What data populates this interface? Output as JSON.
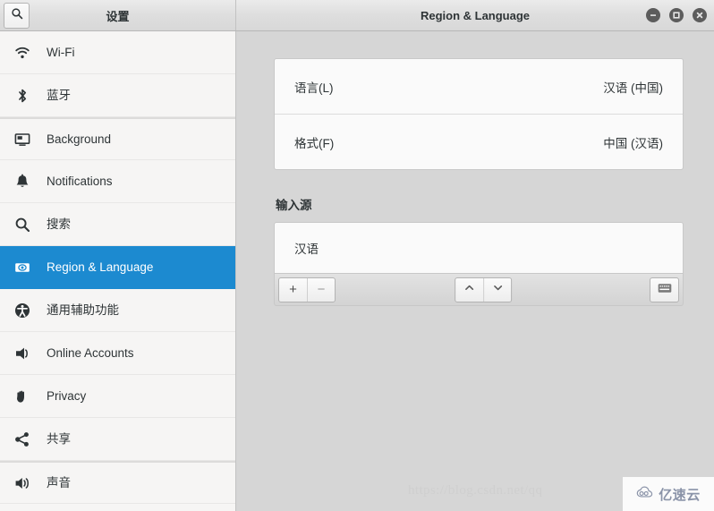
{
  "window": {
    "sidebar_title": "设置",
    "main_title": "Region & Language",
    "search_icon": "search-icon",
    "controls": [
      {
        "name": "minimize",
        "glyph": "minimize-icon"
      },
      {
        "name": "maximize",
        "glyph": "maximize-icon"
      },
      {
        "name": "close",
        "glyph": "close-icon"
      }
    ]
  },
  "sidebar": {
    "items": [
      {
        "label": "Wi-Fi",
        "icon": "wifi-icon",
        "selected": false,
        "group_start": false
      },
      {
        "label": "蓝牙",
        "icon": "bluetooth-icon",
        "selected": false,
        "group_start": false
      },
      {
        "label": "Background",
        "icon": "background-icon",
        "selected": false,
        "group_start": true
      },
      {
        "label": "Notifications",
        "icon": "bell-icon",
        "selected": false,
        "group_start": false
      },
      {
        "label": "搜索",
        "icon": "search-icon",
        "selected": false,
        "group_start": false
      },
      {
        "label": "Region & Language",
        "icon": "region-language-icon",
        "selected": true,
        "group_start": false
      },
      {
        "label": "通用辅助功能",
        "icon": "accessibility-icon",
        "selected": false,
        "group_start": false
      },
      {
        "label": "Online Accounts",
        "icon": "online-accounts-icon",
        "selected": false,
        "group_start": false
      },
      {
        "label": "Privacy",
        "icon": "privacy-hand-icon",
        "selected": false,
        "group_start": false
      },
      {
        "label": "共享",
        "icon": "share-icon",
        "selected": false,
        "group_start": false
      },
      {
        "label": "声音",
        "icon": "sound-icon",
        "selected": false,
        "group_start": true
      }
    ]
  },
  "main": {
    "rows": [
      {
        "label": "语言(L)",
        "value": "汉语 (中国)"
      },
      {
        "label": "格式(F)",
        "value": "中国 (汉语)"
      }
    ],
    "input_sources": {
      "title": "输入源",
      "items": [
        "汉语"
      ],
      "toolbar": {
        "add_label": "+",
        "remove_label": "−",
        "move_up_label": "chevron-up-icon",
        "move_down_label": "chevron-down-icon",
        "keyboard_label": "keyboard-icon"
      }
    }
  },
  "watermarks": {
    "url": "https://blog.csdn.net/qq",
    "logo_text": "亿速云"
  },
  "colors": {
    "accent": "#1c8ad0",
    "sidebar_bg": "#f6f5f4",
    "content_bg": "#d6d6d6",
    "card_bg": "#fafafa",
    "text": "#2e3436"
  }
}
